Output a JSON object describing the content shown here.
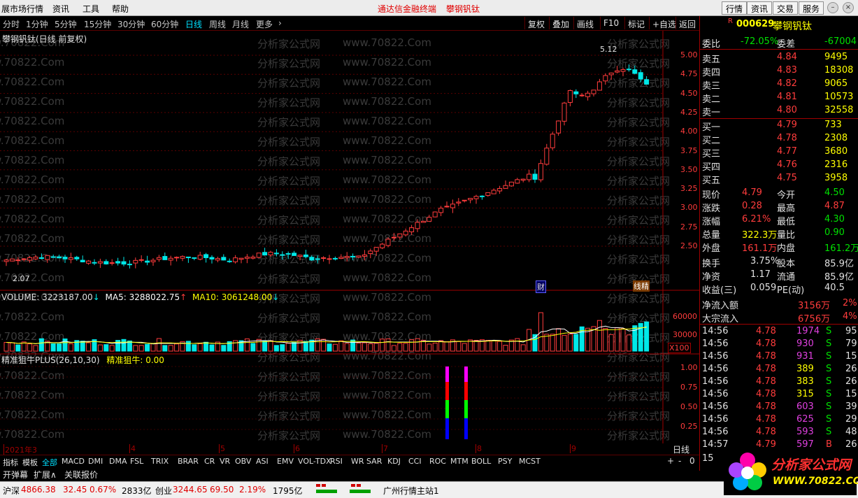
{
  "menubar": {
    "items": [
      "展市场行情",
      "资讯",
      "工具",
      "帮助"
    ],
    "center": [
      "通达信金融终端",
      "攀钢钒钛"
    ],
    "right_buttons": [
      "行情",
      "资讯",
      "交易",
      "服务"
    ]
  },
  "toolbar": {
    "periods": [
      "分时",
      "1分钟",
      "5分钟",
      "15分钟",
      "30分钟",
      "60分钟",
      "日线",
      "周线",
      "月线",
      "更多"
    ],
    "active_period": "日线",
    "more_arrow": "›",
    "buttons": [
      "复权",
      "叠加",
      "画线",
      "F10",
      "标记",
      "+自选",
      "返回"
    ]
  },
  "chart": {
    "title": "攀钢钒钛(日线 前复权)",
    "high_label": "5.12",
    "low_label": "2.07",
    "price_axis": [
      "5.00",
      "4.75",
      "4.50",
      "4.25",
      "4.00",
      "3.75",
      "3.50",
      "3.25",
      "3.00",
      "2.75",
      "2.50"
    ],
    "markers": [
      "财",
      "线精"
    ],
    "volume_label": "VOLUME: 3223187.00",
    "ma5_label": "MA5: 3288022.75",
    "ma10_label": "MA10: 3061248.00",
    "volume_axis": [
      "60000",
      "30000"
    ],
    "volume_unit": "X100",
    "indicator_label": "精准狙牛PLUS(26,10,30)",
    "indicator_value": "精准狙牛: 0.00",
    "indicator_axis": [
      "1.00",
      "0.75",
      "0.50",
      "0.25"
    ],
    "date_axis": [
      "2021年3",
      "4",
      "5",
      "6",
      "7",
      "8",
      "9"
    ],
    "period_label": "日线",
    "watermark": [
      "w.70822.Com",
      "分析家公式网",
      "www.70822.Com"
    ],
    "colors": {
      "up": "#ff3c3c",
      "down": "#00e8e8",
      "ma5": "#ffffff",
      "ma10": "#ffff00",
      "grid": "#8a0000"
    }
  },
  "quote": {
    "flag": "R",
    "code": "000629",
    "name": "攀钢钒钛",
    "weibi_label": "委比",
    "weibi": "-72.05%",
    "weicha_label": "委差",
    "weicha": "-67004",
    "asks": [
      {
        "label": "卖五",
        "price": "4.84",
        "vol": "9495"
      },
      {
        "label": "卖四",
        "price": "4.83",
        "vol": "18308"
      },
      {
        "label": "卖三",
        "price": "4.82",
        "vol": "9065"
      },
      {
        "label": "卖二",
        "price": "4.81",
        "vol": "10573"
      },
      {
        "label": "卖一",
        "price": "4.80",
        "vol": "32558"
      }
    ],
    "bids": [
      {
        "label": "买一",
        "price": "4.79",
        "vol": "733"
      },
      {
        "label": "买二",
        "price": "4.78",
        "vol": "2308"
      },
      {
        "label": "买三",
        "price": "4.77",
        "vol": "3680"
      },
      {
        "label": "买四",
        "price": "4.76",
        "vol": "2316"
      },
      {
        "label": "买五",
        "price": "4.75",
        "vol": "3958"
      }
    ],
    "stats": [
      {
        "l1": "现价",
        "v1": "4.79",
        "c1": "#ff3c3c",
        "l2": "今开",
        "v2": "4.50",
        "c2": "#00e000"
      },
      {
        "l1": "涨跌",
        "v1": "0.28",
        "c1": "#ff3c3c",
        "l2": "最高",
        "v2": "4.87",
        "c2": "#ff3c3c"
      },
      {
        "l1": "涨幅",
        "v1": "6.21%",
        "c1": "#ff3c3c",
        "l2": "最低",
        "v2": "4.30",
        "c2": "#00e000"
      },
      {
        "l1": "总量",
        "v1": "322.3万",
        "c1": "#ffff00",
        "l2": "量比",
        "v2": "0.90",
        "c2": "#00e000"
      },
      {
        "l1": "外盘",
        "v1": "161.1万",
        "c1": "#ff3c3c",
        "l2": "内盘",
        "v2": "161.2万",
        "c2": "#00e000"
      }
    ],
    "stats2": [
      {
        "l1": "换手",
        "v1": "3.75%",
        "l2": "股本",
        "v2": "85.9亿"
      },
      {
        "l1": "净资",
        "v1": "1.17",
        "l2": "流通",
        "v2": "85.9亿"
      },
      {
        "l1": "收益(三)",
        "v1": "0.059",
        "l2": "PE(动)",
        "v2": "40.5"
      }
    ],
    "flows": [
      {
        "label": "净流入额",
        "value": "3156万",
        "pct": "2%"
      },
      {
        "label": "大宗流入",
        "value": "6756万",
        "pct": "4%"
      }
    ],
    "ticks": [
      {
        "t": "14:56",
        "p": "4.78",
        "v": "1974",
        "s": "S",
        "n": "95",
        "vc": "#e040e0"
      },
      {
        "t": "14:56",
        "p": "4.78",
        "v": "930",
        "s": "S",
        "n": "79",
        "vc": "#e040e0"
      },
      {
        "t": "14:56",
        "p": "4.78",
        "v": "931",
        "s": "S",
        "n": "15",
        "vc": "#e040e0"
      },
      {
        "t": "14:56",
        "p": "4.78",
        "v": "389",
        "s": "S",
        "n": "26",
        "vc": "#ffff00"
      },
      {
        "t": "14:56",
        "p": "4.78",
        "v": "383",
        "s": "S",
        "n": "26",
        "vc": "#ffff00"
      },
      {
        "t": "14:56",
        "p": "4.78",
        "v": "315",
        "s": "S",
        "n": "15",
        "vc": "#ffff00"
      },
      {
        "t": "14:56",
        "p": "4.78",
        "v": "603",
        "s": "S",
        "n": "39",
        "vc": "#e040e0"
      },
      {
        "t": "14:56",
        "p": "4.78",
        "v": "625",
        "s": "S",
        "n": "29",
        "vc": "#e040e0"
      },
      {
        "t": "14:56",
        "p": "4.78",
        "v": "593",
        "s": "S",
        "n": "48",
        "vc": "#e040e0"
      },
      {
        "t": "14:57",
        "p": "4.79",
        "v": "597",
        "s": "B",
        "n": "26",
        "vc": "#e040e0"
      }
    ],
    "tick_partial": "15"
  },
  "bottom_tabs": [
    "指标",
    "模板",
    "全部",
    "MACD",
    "DMI",
    "DMA",
    "FSL",
    "TRIX",
    "BRAR",
    "CR",
    "VR",
    "OBV",
    "ASI",
    "EMV",
    "VOL-TDX",
    "RSI",
    "WR",
    "SAR",
    "KDJ",
    "CCI",
    "ROC",
    "MTM",
    "BOLL",
    "PSY",
    "MCST"
  ],
  "bottom_right": [
    "+",
    "-",
    "0"
  ],
  "sub_tabs": [
    "开弹幕",
    "扩展∧",
    "关联报价"
  ],
  "statusbar": {
    "sh_label": "沪深",
    "sh_index": "4866.38",
    "sh_chg": "32.45",
    "sh_pct": "0.67%",
    "sh_amt": "2833亿",
    "cy_label": "创业",
    "cy_index": "3244.65",
    "cy_chg": "69.50",
    "cy_pct": "2.19%",
    "cy_amt": "1795亿",
    "server": "广州行情主站1"
  },
  "logo": {
    "title": "分析家公式网",
    "url": "WWW.70822.COM"
  }
}
